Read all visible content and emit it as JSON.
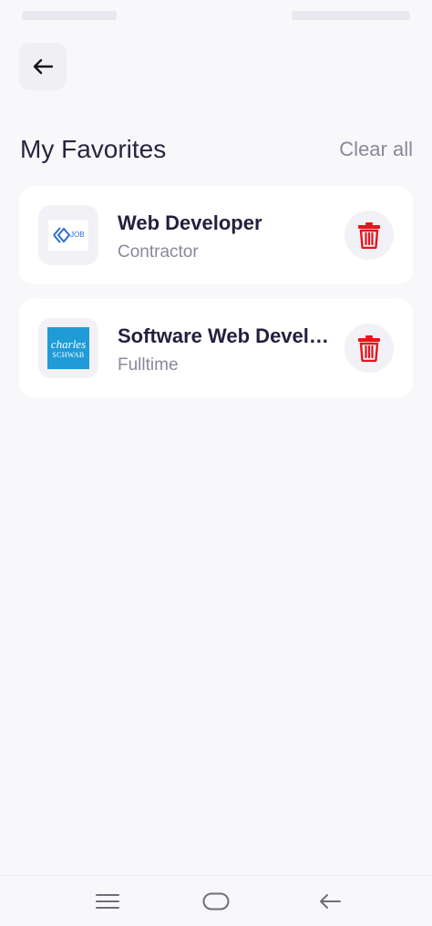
{
  "header": {
    "title": "My Favorites",
    "clear_all_label": "Clear all"
  },
  "favorites": [
    {
      "title": "Web Developer",
      "type": "Contractor",
      "logo": "job-logo"
    },
    {
      "title": "Software Web Developer",
      "type": "Fulltime",
      "logo": "charles-schwab-logo",
      "logo_text_1": "charles",
      "logo_text_2": "SCHWAB"
    }
  ],
  "colors": {
    "background": "#f8f8fb",
    "card": "#ffffff",
    "title_text": "#241f3c",
    "muted_text": "#8a8898",
    "delete_red": "#e8141c",
    "schwab_blue": "#1f9bd7"
  },
  "icons": {
    "back": "arrow-left-icon",
    "delete": "trash-icon",
    "nav_menu": "menu-icon",
    "nav_home": "home-icon",
    "nav_back": "back-icon"
  }
}
